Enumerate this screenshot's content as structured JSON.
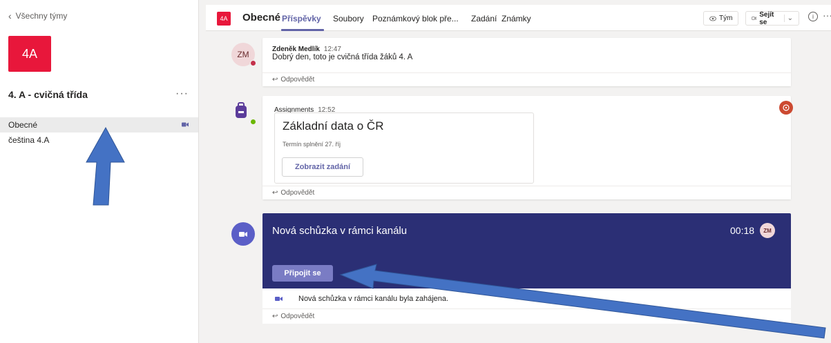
{
  "sidebar": {
    "back_label": "Všechny týmy",
    "team_avatar": "4A",
    "team_name": "4. A - cvičná třída",
    "more": "···",
    "channels": [
      {
        "label": "Obecné"
      },
      {
        "label": "čeština 4.A"
      }
    ]
  },
  "header": {
    "avatar": "4A",
    "title": "Obecné",
    "tabs": [
      {
        "label": "Příspěvky"
      },
      {
        "label": "Soubory"
      },
      {
        "label": "Poznámkový blok pře..."
      },
      {
        "label": "Zadání"
      },
      {
        "label": "Známky"
      }
    ],
    "team_button": "Tým",
    "meet_button": "Sejít se",
    "info": "i",
    "more": "···"
  },
  "messages": {
    "first": {
      "avatar": "ZM",
      "author": "Zdeněk Medlík",
      "time": "12:47",
      "text": "Dobrý den, toto je cvičná třída žáků 4. A",
      "reply": "Odpovědět"
    },
    "assignment": {
      "author": "Assignments",
      "time": "12:52",
      "title": "Základní data o ČR",
      "due": "Termín splnění 27. říj",
      "button": "Zobrazit zadání",
      "reply": "Odpovědět"
    },
    "meeting": {
      "title": "Nová schůzka v rámci kanálu",
      "timer": "00:18",
      "avatar": "ZM",
      "join": "Připojit se",
      "started": "Nová schůzka v rámci kanálu byla zahájena.",
      "reply": "Odpovědět"
    }
  },
  "colors": {
    "brand": "#6264a7",
    "team_red": "#e8173b",
    "meeting_bg": "#2b2f75",
    "arrow": "#4472c4"
  }
}
